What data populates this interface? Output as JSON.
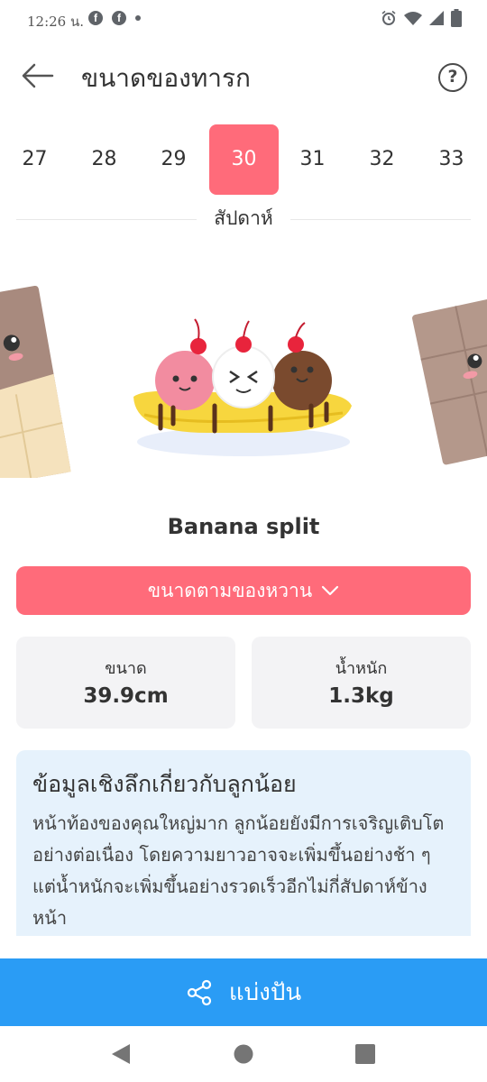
{
  "status_bar": {
    "time": "12:26 น.",
    "left_icons": [
      "facebook-icon",
      "facebook-icon",
      "dot-icon"
    ],
    "right_icons": [
      "alarm-icon",
      "wifi-icon",
      "signal-icon",
      "battery-icon"
    ]
  },
  "header": {
    "title": "ขนาดของทารก",
    "help_label": "?"
  },
  "weeks": {
    "items": [
      "27",
      "28",
      "29",
      "30",
      "31",
      "32",
      "33"
    ],
    "selected": "30",
    "caption": "สัปดาห์"
  },
  "fruit": {
    "name": "Banana split"
  },
  "compare": {
    "label": "ขนาดตามของหวาน"
  },
  "stats": {
    "size_label": "ขนาด",
    "size_value": "39.9cm",
    "weight_label": "น้ำหนัก",
    "weight_value": "1.3kg"
  },
  "insight": {
    "title": "ข้อมูลเชิงลึกเกี่ยวกับลูกน้อย",
    "body": "หน้าท้องของคุณใหญ่มาก ลูกน้อยยังมีการเจริญเติบโตอย่างต่อเนื่อง โดยความยาวอาจจะเพิ่มขึ้นอย่างช้า ๆ แต่น้ำหนักจะเพิ่มขึ้นอย่างรวดเร็วอีกไม่กี่สัปดาห์ข้างหน้า"
  },
  "share": {
    "label": "แบ่งปัน"
  },
  "colors": {
    "accent_pink": "#ff6b7a",
    "share_blue": "#2a9cf5",
    "card_gray": "#f3f3f5",
    "insight_blue": "#e6f2fc"
  }
}
